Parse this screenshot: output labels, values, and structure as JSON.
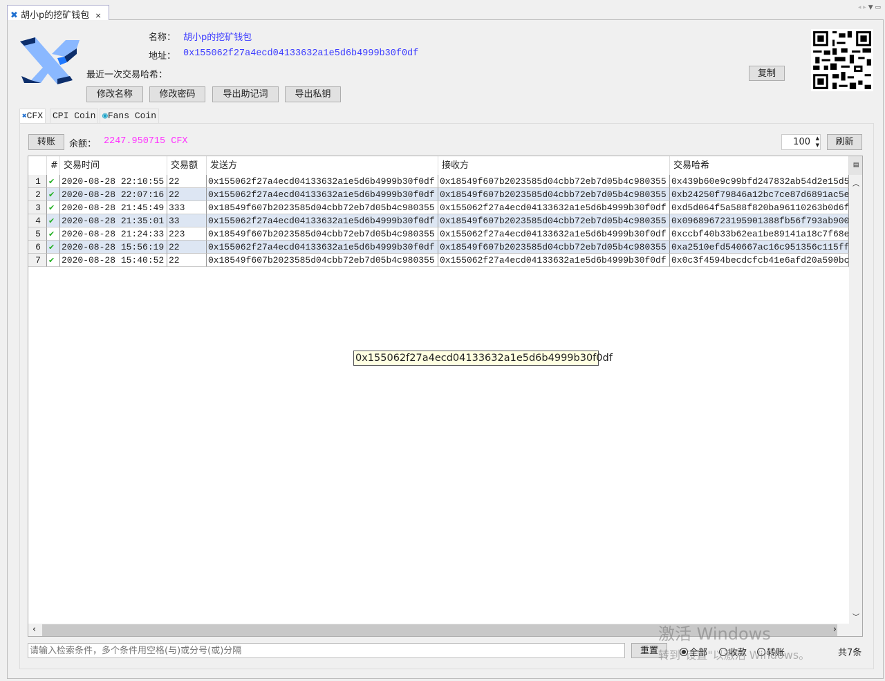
{
  "tab": {
    "title": "胡小p的挖矿钱包",
    "close": "×"
  },
  "wallet": {
    "name_label": "名称：",
    "name": "胡小p的挖矿钱包",
    "address_label": "地址：",
    "address": "0x155062f27a4ecd04133632a1e5d6b4999b30f0df",
    "last_hash_label": "最近一次交易哈希：",
    "copy": "复制"
  },
  "actions": [
    "修改名称",
    "修改密码",
    "导出助记词",
    "导出私钥"
  ],
  "coin_tabs": [
    "CFX",
    "CPI Coin",
    "Fans Coin"
  ],
  "toolbar": {
    "transfer": "转账",
    "balance_label": "余额：",
    "balance": "2247.950715 CFX",
    "page_size": "100",
    "refresh": "刷新"
  },
  "table": {
    "columns": [
      "#",
      "交易时间",
      "交易额",
      "发送方",
      "接收方",
      "交易哈希"
    ],
    "rows": [
      [
        "1",
        "2020-08-28 22:10:55",
        "22",
        "0x155062f27a4ecd04133632a1e5d6b4999b30f0df",
        "0x18549f607b2023585d04cbb72eb7d05b4c980355",
        "0x439b60e9c99bfd247832ab54d2e15d5"
      ],
      [
        "2",
        "2020-08-28 22:07:16",
        "22",
        "0x155062f27a4ecd04133632a1e5d6b4999b30f0df",
        "0x18549f607b2023585d04cbb72eb7d05b4c980355",
        "0xb24250f79846a12bc7ce87d6891ac5e"
      ],
      [
        "3",
        "2020-08-28 21:45:49",
        "333",
        "0x18549f607b2023585d04cbb72eb7d05b4c980355",
        "0x155062f27a4ecd04133632a1e5d6b4999b30f0df",
        "0xd5d064f5a588f820ba96110263b0d6f"
      ],
      [
        "4",
        "2020-08-28 21:35:01",
        "33",
        "0x155062f27a4ecd04133632a1e5d6b4999b30f0df",
        "0x18549f607b2023585d04cbb72eb7d05b4c980355",
        "0x096896723195901388fb56f793ab900"
      ],
      [
        "5",
        "2020-08-28 21:24:33",
        "223",
        "0x18549f607b2023585d04cbb72eb7d05b4c980355",
        "0x155062f27a4ecd04133632a1e5d6b4999b30f0df",
        "0xccbf40b33b62ea1be89141a18c7f68e"
      ],
      [
        "6",
        "2020-08-28 15:56:19",
        "22",
        "0x155062f27a4ecd04133632a1e5d6b4999b30f0df",
        "0x18549f607b2023585d04cbb72eb7d05b4c980355",
        "0xa2510efd540667ac16c951356c115ff"
      ],
      [
        "7",
        "2020-08-28 15:40:52",
        "22",
        "0x18549f607b2023585d04cbb72eb7d05b4c980355",
        "0x155062f27a4ecd04133632a1e5d6b4999b30f0df",
        "0x0c3f4594becdcfcb41e6afd20a590bc"
      ]
    ],
    "tooltip": "0x155062f27a4ecd04133632a1e5d6b4999b30f0df"
  },
  "footer": {
    "search_placeholder": "请输入检索条件，多个条件用空格(与)或分号(或)分隔",
    "reset": "重置",
    "filters": [
      "全部",
      "收款",
      "转账"
    ],
    "count": "共7条"
  },
  "watermark": {
    "line1": "激活 Windows",
    "line2": "转到\"设置\"以激活 Windows。"
  },
  "colors": {
    "accent": "#3b3bff",
    "balance": "#ff33ff",
    "row_alt": "#dde6f3",
    "check": "#22b022"
  }
}
